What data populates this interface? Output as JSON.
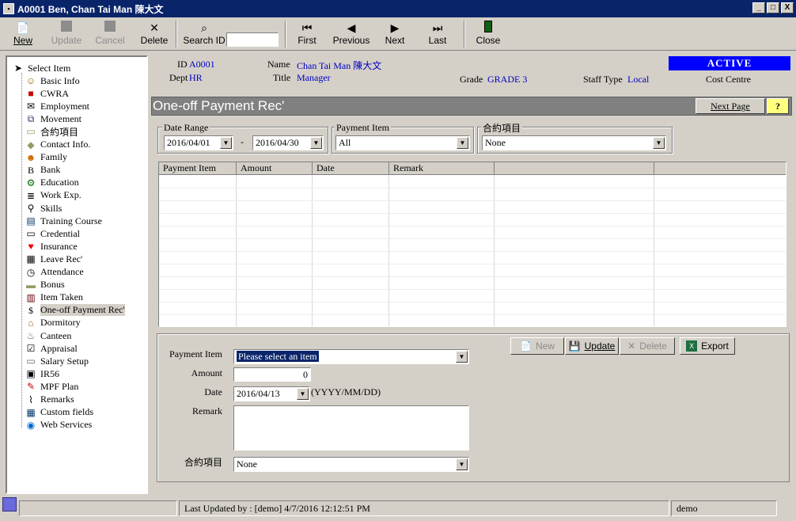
{
  "window": {
    "title": "A0001 Ben, Chan Tai Man 陳大文",
    "minimize": "_",
    "restore": "□",
    "close": "X"
  },
  "toolbar": {
    "new": "New",
    "update": "Update",
    "cancel": "Cancel",
    "delete": "Delete",
    "search_id": "Search ID",
    "search_value": "",
    "first": "First",
    "previous": "Previous",
    "next": "Next",
    "last": "Last",
    "close": "Close"
  },
  "tree": {
    "root": "Select Item",
    "items": [
      "Basic Info",
      "CWRA",
      "Employment",
      "Movement",
      "合約項目",
      "Contact Info.",
      "Family",
      "Bank",
      "Education",
      "Work Exp.",
      "Skills",
      "Training Course",
      "Credential",
      "Insurance",
      "Leave Rec'",
      "Attendance",
      "Bonus",
      "Item Taken",
      "One-off Payment Rec'",
      "Dormitory",
      "Canteen",
      "Appraisal",
      "Salary Setup",
      "IR56",
      "MPF Plan",
      "Remarks",
      "Custom fields",
      "Web Services"
    ],
    "selected": "One-off Payment Rec'"
  },
  "header": {
    "id_label": "ID",
    "id_value": "A0001",
    "dept_label": "Dept",
    "dept_value": "HR",
    "name_label": "Name",
    "name_value": "Chan Tai Man  陳大文",
    "title_label": "Title",
    "title_value": "Manager",
    "grade_label": "Grade",
    "grade_value": "GRADE 3",
    "staff_type_label": "Staff Type",
    "staff_type_value": "Local",
    "status": "ACTIVE",
    "cost_centre_label": "Cost Centre"
  },
  "section": {
    "title": "One-off Payment Rec'",
    "next_page": "Next Page",
    "help": "?"
  },
  "filters": {
    "date_range_label": "Date Range",
    "date_from": "2016/04/01",
    "dash": "-",
    "date_to": "2016/04/30",
    "payment_item_label": "Payment Item",
    "payment_item_value": "All",
    "contract_label": "合約項目",
    "contract_value": "None"
  },
  "grid": {
    "columns": [
      "Payment Item",
      "Amount",
      "Date",
      "Remark",
      "",
      ""
    ],
    "rows": []
  },
  "form": {
    "payment_item_label": "Payment Item",
    "payment_item_value": "Please select an item",
    "amount_label": "Amount",
    "amount_value": "0",
    "date_label": "Date",
    "date_value": "2016/04/13",
    "date_format": "(YYYY/MM/DD)",
    "remark_label": "Remark",
    "remark_value": "",
    "contract_label": "合約項目",
    "contract_value": "None",
    "btn_new": "New",
    "btn_update": "Update",
    "btn_delete": "Delete",
    "btn_export": "Export"
  },
  "status": {
    "last_updated": "Last Updated by : [demo]  4/7/2016 12:12:51 PM",
    "user": "demo"
  }
}
